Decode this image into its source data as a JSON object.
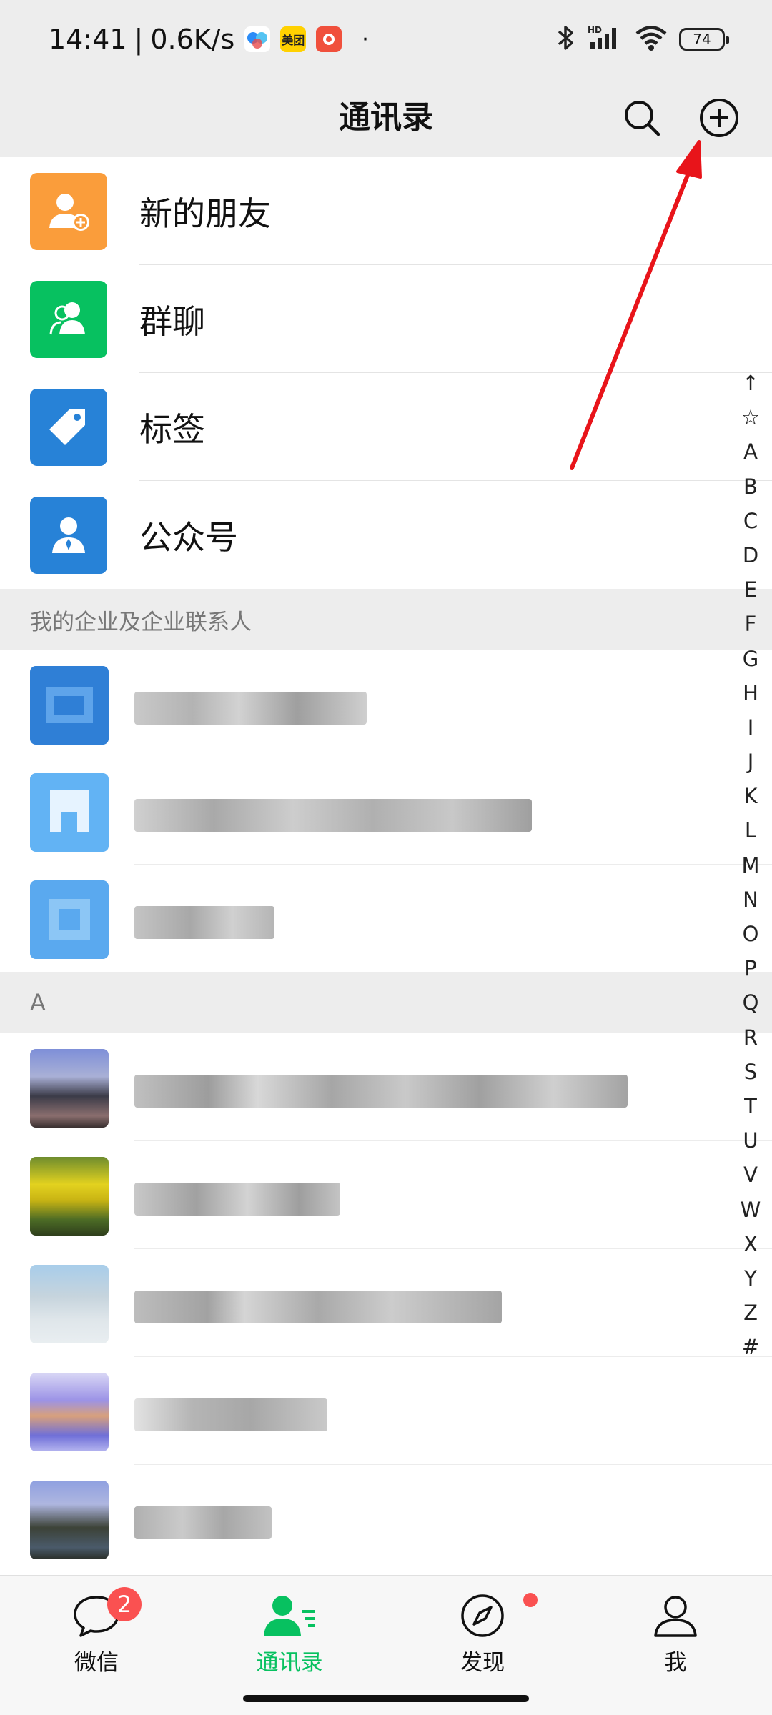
{
  "status_bar": {
    "time": "14:41",
    "separator": "|",
    "net_speed": "0.6K/s",
    "meituan_label": "美团",
    "dot": "·",
    "battery": "74",
    "icons": [
      "baidu-netdisk-icon",
      "meituan-icon",
      "app-icon",
      "bluetooth-icon",
      "signal-icon",
      "wifi-icon",
      "battery-icon"
    ]
  },
  "header": {
    "title": "通讯录",
    "search_icon": "search-icon",
    "add_icon": "add-circle-icon"
  },
  "functions": [
    {
      "label": "新的朋友",
      "icon": "add-friend-icon",
      "color": "#fa9d3b"
    },
    {
      "label": "群聊",
      "icon": "group-icon",
      "color": "#07c160"
    },
    {
      "label": "标签",
      "icon": "tag-icon",
      "color": "#2782d7"
    },
    {
      "label": "公众号",
      "icon": "official-account-icon",
      "color": "#2782d7"
    }
  ],
  "enterprise_section": {
    "header": "我的企业及企业联系人"
  },
  "letter_section": {
    "header": "A"
  },
  "index_letters": [
    "↑",
    "☆",
    "A",
    "B",
    "C",
    "D",
    "E",
    "F",
    "G",
    "H",
    "I",
    "J",
    "K",
    "L",
    "M",
    "N",
    "O",
    "P",
    "Q",
    "R",
    "S",
    "T",
    "U",
    "V",
    "W",
    "X",
    "Y",
    "Z",
    "#"
  ],
  "tabs": [
    {
      "label": "微信",
      "icon": "chat-icon",
      "badge": "2"
    },
    {
      "label": "通讯录",
      "icon": "contacts-icon",
      "active": true
    },
    {
      "label": "发现",
      "icon": "compass-icon",
      "dot": true
    },
    {
      "label": "我",
      "icon": "person-icon"
    }
  ],
  "colors": {
    "accent": "#07c160",
    "badge": "#fa5151",
    "annotation_arrow": "#e8141a"
  }
}
